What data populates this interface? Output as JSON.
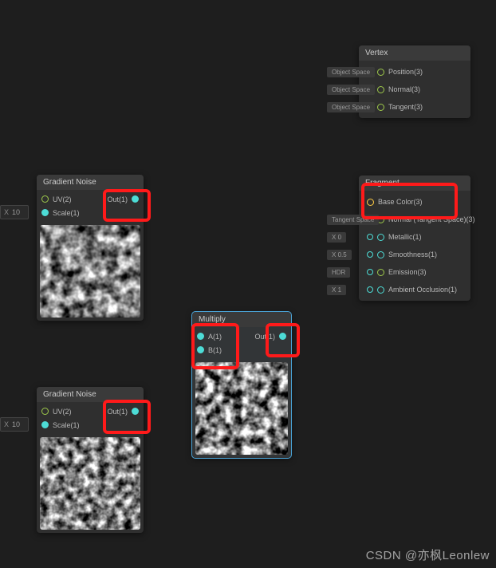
{
  "nodes": {
    "gn1": {
      "title": "Gradient Noise",
      "inputs": {
        "uv": "UV(2)",
        "scale": "Scale(1)"
      },
      "outputs": {
        "out": "Out(1)"
      },
      "scale_value": "10",
      "scale_prefix": "X"
    },
    "gn2": {
      "title": "Gradient Noise",
      "inputs": {
        "uv": "UV(2)",
        "scale": "Scale(1)"
      },
      "outputs": {
        "out": "Out(1)"
      },
      "scale_value": "10",
      "scale_prefix": "X"
    },
    "mul": {
      "title": "Multiply",
      "inputs": {
        "a": "A(1)",
        "b": "B(1)"
      },
      "outputs": {
        "out": "Out(1)"
      }
    },
    "vertex": {
      "title": "Vertex",
      "rows": [
        {
          "tag": "Object Space",
          "label": "Position(3)"
        },
        {
          "tag": "Object Space",
          "label": "Normal(3)"
        },
        {
          "tag": "Object Space",
          "label": "Tangent(3)"
        }
      ]
    },
    "fragment": {
      "title": "Fragment",
      "rows": {
        "basecolor": {
          "tag": "",
          "label": "Base Color(3)"
        },
        "normal": {
          "tag": "Tangent Space",
          "label": "Normal (Tangent Space)(3)"
        },
        "metallic": {
          "tag_prefix": "X",
          "tag_val": "0",
          "label": "Metallic(1)"
        },
        "smooth": {
          "tag_prefix": "X",
          "tag_val": "0.5",
          "label": "Smoothness(1)"
        },
        "emission": {
          "tag": "HDR",
          "label": "Emission(3)"
        },
        "ao": {
          "tag_prefix": "X",
          "tag_val": "1",
          "label": "Ambient Occlusion(1)"
        }
      }
    }
  },
  "watermark": "CSDN @亦枫Leonlew"
}
